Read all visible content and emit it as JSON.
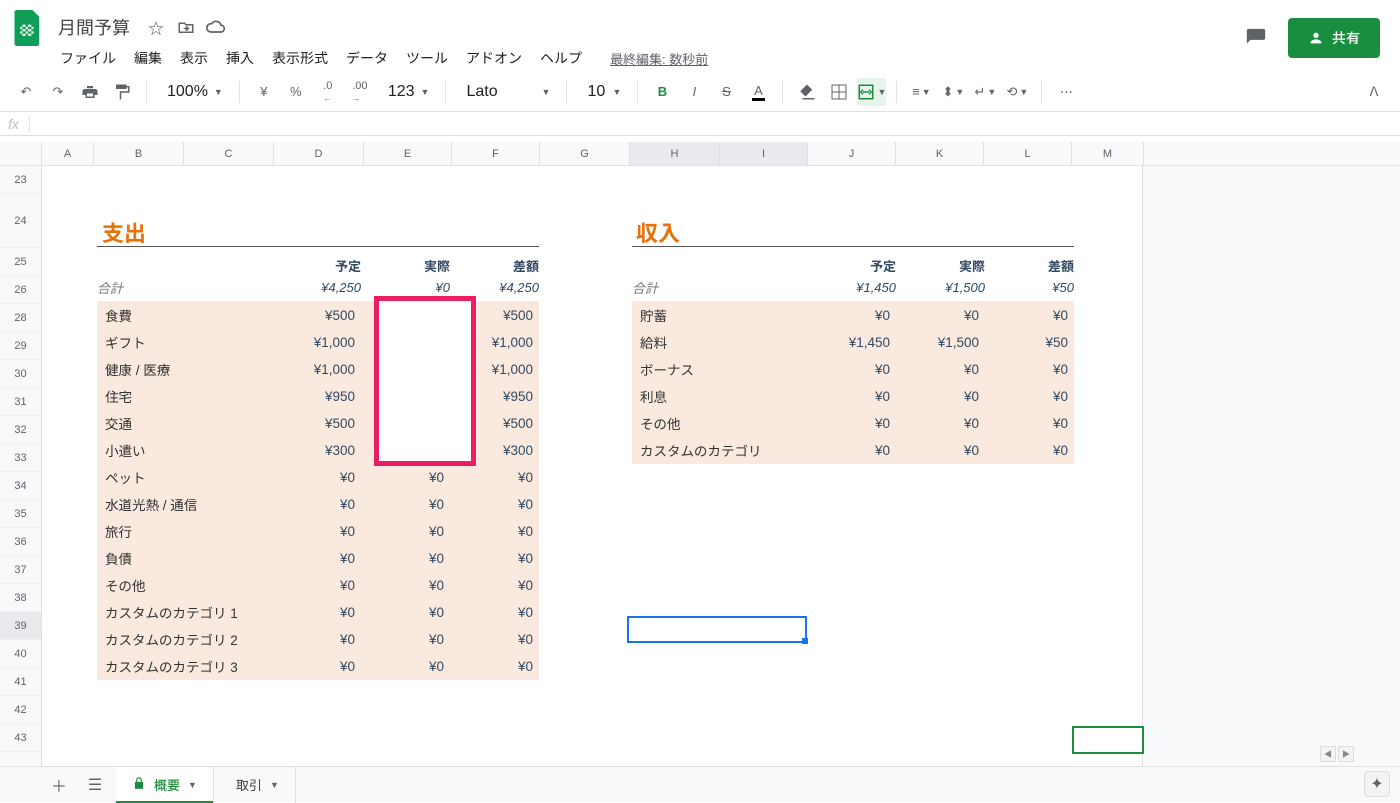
{
  "doc_title": "月間予算",
  "menus": [
    "ファイル",
    "編集",
    "表示",
    "挿入",
    "表示形式",
    "データ",
    "ツール",
    "アドオン",
    "ヘルプ"
  ],
  "last_edit": "最終編集: 数秒前",
  "share_label": "共有",
  "toolbar": {
    "zoom": "100%",
    "currency": "¥",
    "percent": "%",
    "dec_dec": ".0",
    "dec_inc": ".00",
    "fmt": "123",
    "font": "Lato",
    "size": "10"
  },
  "columns": [
    "A",
    "B",
    "C",
    "D",
    "E",
    "F",
    "G",
    "H",
    "I",
    "J",
    "K",
    "L",
    "M"
  ],
  "rows": [
    "23",
    "24",
    "25",
    "26",
    "28",
    "29",
    "30",
    "31",
    "32",
    "33",
    "34",
    "35",
    "36",
    "37",
    "38",
    "39",
    "40",
    "41",
    "42",
    "43"
  ],
  "expenses": {
    "title": "支出",
    "headers": {
      "plan": "予定",
      "actual": "実際",
      "diff": "差額"
    },
    "total": {
      "label": "合計",
      "plan": "¥4,250",
      "actual": "¥0",
      "diff": "¥4,250"
    },
    "rows": [
      {
        "label": "食費",
        "plan": "¥500",
        "actual": "",
        "diff": "¥500"
      },
      {
        "label": "ギフト",
        "plan": "¥1,000",
        "actual": "",
        "diff": "¥1,000"
      },
      {
        "label": "健康 / 医療",
        "plan": "¥1,000",
        "actual": "",
        "diff": "¥1,000"
      },
      {
        "label": "住宅",
        "plan": "¥950",
        "actual": "",
        "diff": "¥950"
      },
      {
        "label": "交通",
        "plan": "¥500",
        "actual": "",
        "diff": "¥500"
      },
      {
        "label": "小遣い",
        "plan": "¥300",
        "actual": "",
        "diff": "¥300"
      },
      {
        "label": "ペット",
        "plan": "¥0",
        "actual": "¥0",
        "diff": "¥0"
      },
      {
        "label": "水道光熱 / 通信",
        "plan": "¥0",
        "actual": "¥0",
        "diff": "¥0"
      },
      {
        "label": "旅行",
        "plan": "¥0",
        "actual": "¥0",
        "diff": "¥0"
      },
      {
        "label": "負債",
        "plan": "¥0",
        "actual": "¥0",
        "diff": "¥0"
      },
      {
        "label": "その他",
        "plan": "¥0",
        "actual": "¥0",
        "diff": "¥0"
      },
      {
        "label": "カスタムのカテゴリ 1",
        "plan": "¥0",
        "actual": "¥0",
        "diff": "¥0"
      },
      {
        "label": "カスタムのカテゴリ 2",
        "plan": "¥0",
        "actual": "¥0",
        "diff": "¥0"
      },
      {
        "label": "カスタムのカテゴリ 3",
        "plan": "¥0",
        "actual": "¥0",
        "diff": "¥0"
      }
    ]
  },
  "income": {
    "title": "収入",
    "headers": {
      "plan": "予定",
      "actual": "実際",
      "diff": "差額"
    },
    "total": {
      "label": "合計",
      "plan": "¥1,450",
      "actual": "¥1,500",
      "diff": "¥50"
    },
    "rows": [
      {
        "label": "貯蓄",
        "plan": "¥0",
        "actual": "¥0",
        "diff": "¥0"
      },
      {
        "label": "給料",
        "plan": "¥1,450",
        "actual": "¥1,500",
        "diff": "¥50"
      },
      {
        "label": "ボーナス",
        "plan": "¥0",
        "actual": "¥0",
        "diff": "¥0"
      },
      {
        "label": "利息",
        "plan": "¥0",
        "actual": "¥0",
        "diff": "¥0"
      },
      {
        "label": "その他",
        "plan": "¥0",
        "actual": "¥0",
        "diff": "¥0"
      },
      {
        "label": "カスタムのカテゴリ",
        "plan": "¥0",
        "actual": "¥0",
        "diff": "¥0"
      }
    ]
  },
  "sheet_tabs": {
    "active": "概要",
    "other": "取引"
  }
}
